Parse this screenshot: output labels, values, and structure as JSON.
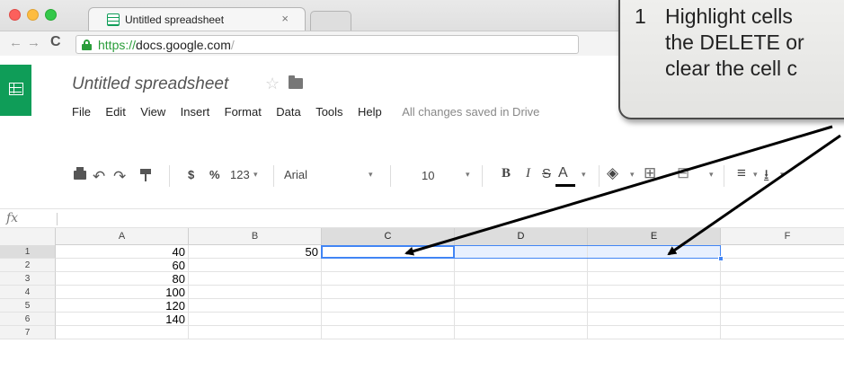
{
  "browser": {
    "tab_title": "Untitled spreadsheet",
    "tab_close": "×",
    "url_scheme": "https://",
    "url_host": "docs.google.com",
    "url_suffix": "/"
  },
  "app": {
    "title": "Untitled spreadsheet",
    "menu": [
      "File",
      "Edit",
      "View",
      "Insert",
      "Format",
      "Data",
      "Tools",
      "Help"
    ],
    "save_status": "All changes saved in Drive"
  },
  "toolbar": {
    "currency": "$",
    "percent": "%",
    "number_format": "123",
    "font": "Arial",
    "font_size": "10",
    "bold": "B",
    "italic": "I",
    "strike": "S",
    "text_color": "A",
    "dropdown_caret": "▾"
  },
  "formula_bar": {
    "label": "fx",
    "value": ""
  },
  "grid": {
    "columns": [
      "A",
      "B",
      "C",
      "D",
      "E",
      "F"
    ],
    "selected_columns": [
      "C",
      "D",
      "E"
    ],
    "rows": [
      {
        "num": "1",
        "A": "40",
        "B": "50"
      },
      {
        "num": "2",
        "A": "60",
        "B": ""
      },
      {
        "num": "3",
        "A": "80",
        "B": ""
      },
      {
        "num": "4",
        "A": "100",
        "B": ""
      },
      {
        "num": "5",
        "A": "120",
        "B": ""
      },
      {
        "num": "6",
        "A": "140",
        "B": ""
      },
      {
        "num": "7",
        "A": "",
        "B": ""
      }
    ]
  },
  "callout": {
    "number": "1",
    "lines": [
      "Highlight cells",
      "the DELETE or",
      "clear the cell c"
    ]
  },
  "colors": {
    "sheets_green": "#0f9d58",
    "selection_blue": "#4285f4",
    "secure_green": "#2a9d3a"
  }
}
